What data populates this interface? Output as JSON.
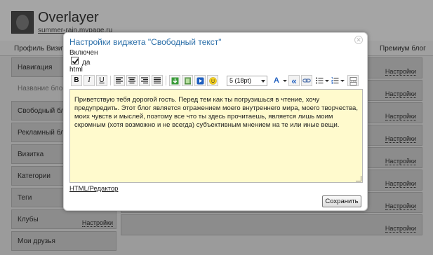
{
  "background": {
    "site_title": "Overlayer",
    "site_url": "summer-rain.mypage.ru",
    "nav": [
      "Профиль",
      "Визит",
      "Премиум блог"
    ],
    "left_blocks": [
      {
        "label": "Навигация",
        "settings": "Настройки"
      },
      {
        "label": "Название блога",
        "settings": ""
      },
      {
        "label": "Свободный блок",
        "settings": "Настройки"
      },
      {
        "label": "Рекламный блок",
        "settings": "Настройки"
      },
      {
        "label": "Визитка",
        "settings": "Настройки"
      },
      {
        "label": "Категории",
        "settings": "Настройки"
      },
      {
        "label": "Теги",
        "settings": "Настройки"
      },
      {
        "label": "Клубы",
        "settings": "Настройки"
      },
      {
        "label": "Мои друзья",
        "settings": ""
      }
    ],
    "right_settings": "Настройки"
  },
  "dialog": {
    "title": "Настройки виджета \"Свободный текст\"",
    "close": "✕",
    "enabled_label": "Включен",
    "enabled_value": "да",
    "html_label": "html",
    "font_size_value": "5 (18pt)",
    "toolbar": {
      "bold": "B",
      "italic": "I",
      "underline": "U",
      "font_color": "A",
      "quote": "«"
    },
    "content": "Приветствую тебя дорогой гость. Перед тем как ты погрузишься в чтение, хочу предупредить. Этот блог является отражением моего внутреннего мира, моего творчества, моих чувств и мыслей, поэтому все что ты здесь прочитаешь, является лишь моим скромным (хотя возможно и не всегда) субъективным мнением на те или иные вещи.",
    "html_editor_link": "HTML/Редактор",
    "save_button": "Сохранить"
  },
  "colors": {
    "title_blue": "#2a6ea8",
    "editor_bg": "#fffacd",
    "overlay": "#9b9b9b"
  },
  "icons": [
    "align-left-icon",
    "align-center-icon",
    "align-right-icon",
    "align-justify-icon",
    "insert-image-icon",
    "insert-film-icon",
    "insert-video-icon",
    "smiley-icon",
    "font-color-icon",
    "quote-icon",
    "link-icon",
    "bullet-list-icon",
    "numbered-list-icon",
    "page-break-icon",
    "close-icon"
  ]
}
